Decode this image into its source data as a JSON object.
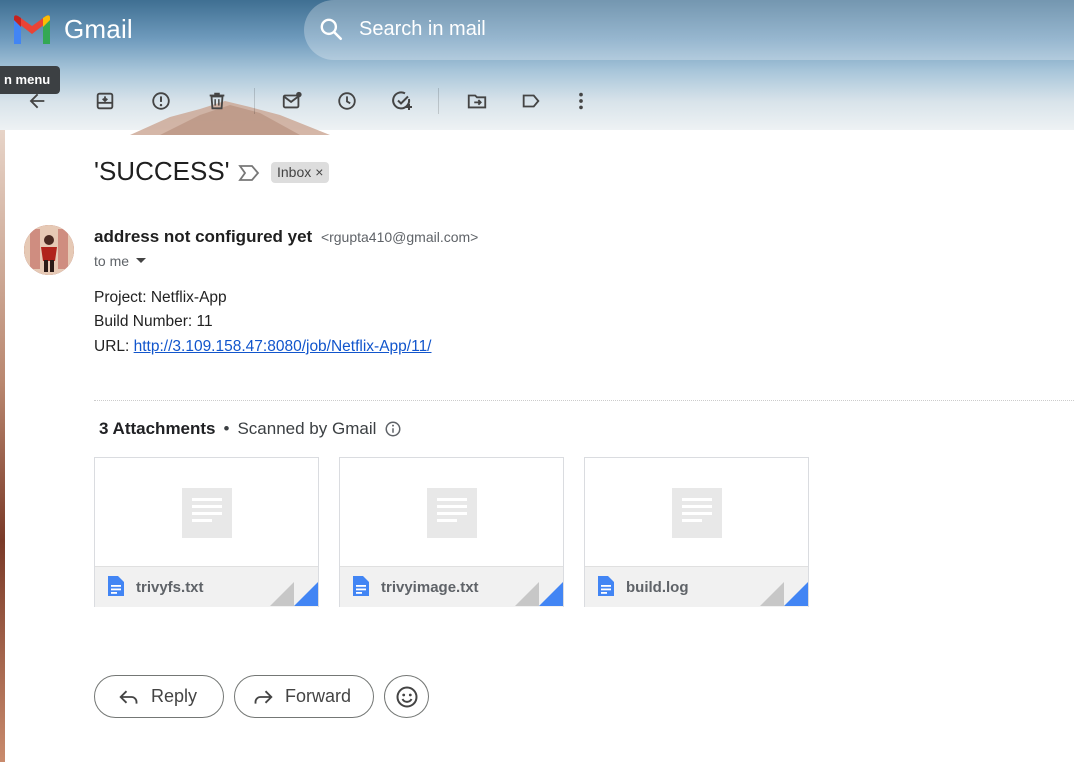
{
  "app": {
    "name": "Gmail"
  },
  "search": {
    "placeholder": "Search in mail"
  },
  "tooltip": {
    "text": "n menu"
  },
  "toolbar": {
    "icons": [
      "back-arrow-icon",
      "archive-icon",
      "report-spam-icon",
      "delete-icon",
      "mark-unread-icon",
      "snooze-icon",
      "add-to-tasks-icon",
      "move-to-icon",
      "labels-icon",
      "more-icon"
    ]
  },
  "email": {
    "subject": "'SUCCESS'",
    "label_chip": "Inbox",
    "chip_close": "×",
    "sender_name": "address not configured yet",
    "sender_email": "<rgupta410@gmail.com>",
    "to": "to me",
    "body": {
      "project": "Project: Netflix-App",
      "build": "Build Number: 11",
      "url_prefix": "URL: ",
      "url": "http://3.109.158.47:8080/job/Netflix-App/11/"
    }
  },
  "attachments": {
    "title": "3 Attachments",
    "bullet": "•",
    "scanned": "Scanned by Gmail",
    "files": [
      {
        "name": "trivyfs.txt"
      },
      {
        "name": "trivyimage.txt"
      },
      {
        "name": "build.log"
      }
    ]
  },
  "actions": {
    "reply": "Reply",
    "forward": "Forward"
  },
  "colors": {
    "accent_blue": "#4285f4",
    "link": "#1155cc",
    "chip_bg": "#dddddd"
  }
}
